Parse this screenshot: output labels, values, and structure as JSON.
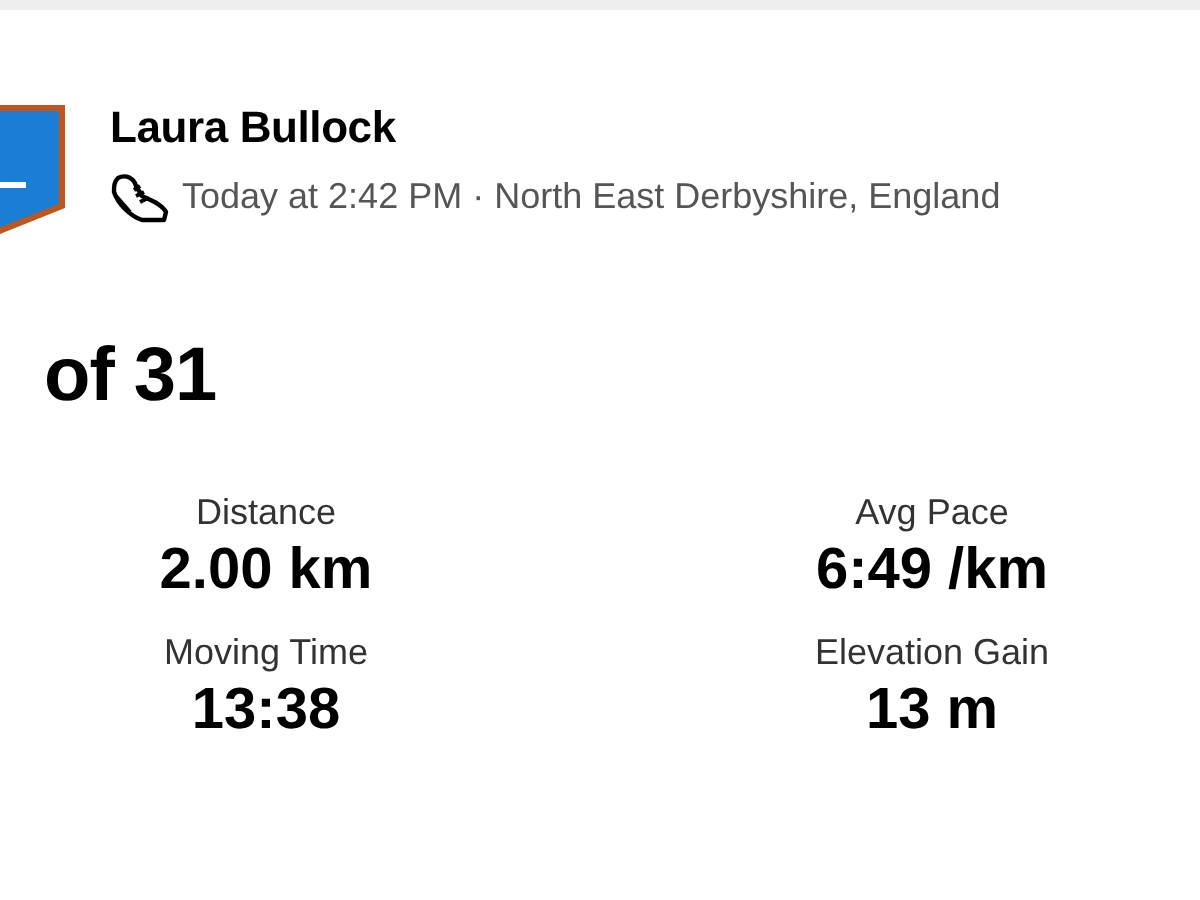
{
  "athlete": {
    "name": "Laura Bullock",
    "meta": "Today at 2:42 PM · North East Derbyshire, England"
  },
  "title": "of 31",
  "stats": [
    {
      "label": "Distance",
      "value": "2.00 km"
    },
    {
      "label": "Avg Pace",
      "value": "6:49 /km"
    },
    {
      "label": "Moving Time",
      "value": "13:38"
    },
    {
      "label": "Elevation Gain",
      "value": "13 m"
    }
  ]
}
